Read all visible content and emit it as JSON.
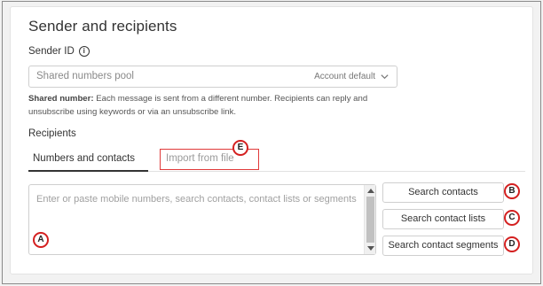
{
  "section": {
    "title": "Sender and recipients"
  },
  "sender": {
    "label": "Sender ID",
    "info_icon": "info-icon",
    "select_value": "Shared numbers pool",
    "select_hint": "Account default",
    "help_bold": "Shared number:",
    "help_text": " Each message is sent from a different number. Recipients can reply and unsubscribe using keywords or via an unsubscribe link."
  },
  "recipients": {
    "label": "Recipients",
    "tabs": [
      {
        "label": "Numbers and contacts"
      },
      {
        "label": "Import from file"
      }
    ],
    "textarea_placeholder": "Enter or paste mobile numbers, search contacts, contact lists or segments",
    "buttons": [
      {
        "label": "Search contacts"
      },
      {
        "label": "Search contact lists"
      },
      {
        "label": "Search contact segments"
      }
    ]
  },
  "markers": [
    "A",
    "B",
    "C",
    "D",
    "E"
  ],
  "colors": {
    "marker_border": "#d42020",
    "active_tab_underline": "#333333"
  }
}
